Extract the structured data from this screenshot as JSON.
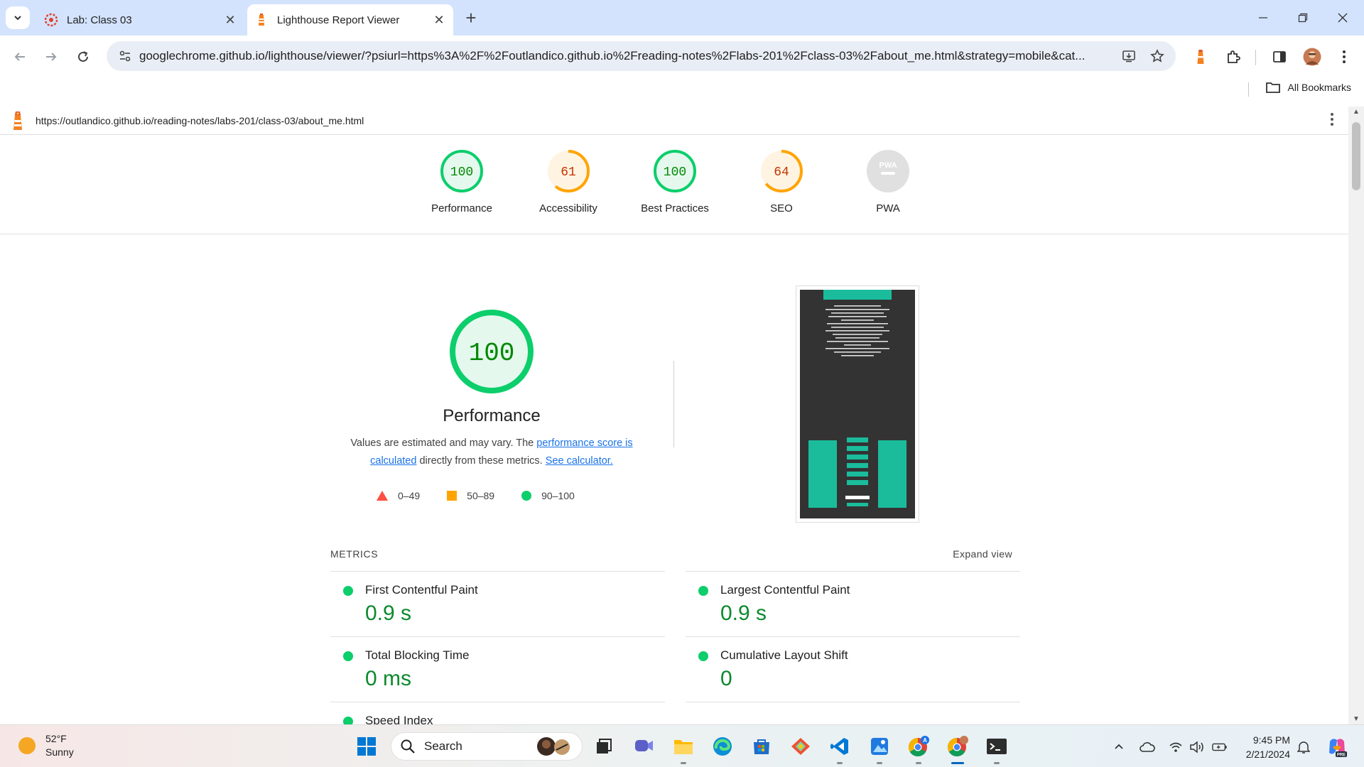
{
  "browser": {
    "tabs": [
      {
        "title": "Lab: Class 03",
        "active": false
      },
      {
        "title": "Lighthouse Report Viewer",
        "active": true
      }
    ],
    "omnibox_url": "googlechrome.github.io/lighthouse/viewer/?psiurl=https%3A%2F%2Foutlandico.github.io%2Freading-notes%2Flabs-201%2Fclass-03%2Fabout_me.html&strategy=mobile&cat...",
    "bookmarks_label": "All Bookmarks"
  },
  "report": {
    "page_url": "https://outlandico.github.io/reading-notes/labs-201/class-03/about_me.html",
    "categories": [
      {
        "label": "Performance",
        "score": "100",
        "value": 100,
        "rating": "pass"
      },
      {
        "label": "Accessibility",
        "score": "61",
        "value": 61,
        "rating": "average"
      },
      {
        "label": "Best Practices",
        "score": "100",
        "value": 100,
        "rating": "pass"
      },
      {
        "label": "SEO",
        "score": "64",
        "value": 64,
        "rating": "average"
      },
      {
        "label": "PWA",
        "score": "PWA",
        "value": null,
        "rating": "na"
      }
    ],
    "performance": {
      "score": "100",
      "title": "Performance",
      "desc_prefix": "Values are estimated and may vary. The ",
      "desc_link1": "performance score is calculated",
      "desc_middle": " directly from these metrics. ",
      "desc_link2": "See calculator.",
      "legend": [
        {
          "range": "0–49",
          "shape": "triangle",
          "color": "#ff4e42"
        },
        {
          "range": "50–89",
          "shape": "square",
          "color": "#ffa400"
        },
        {
          "range": "90–100",
          "shape": "circle",
          "color": "#0cce6b"
        }
      ]
    },
    "metrics_heading": "METRICS",
    "expand_label": "Expand view",
    "metrics": [
      {
        "name": "First Contentful Paint",
        "value": "0.9 s"
      },
      {
        "name": "Largest Contentful Paint",
        "value": "0.9 s"
      },
      {
        "name": "Total Blocking Time",
        "value": "0 ms"
      },
      {
        "name": "Cumulative Layout Shift",
        "value": "0"
      },
      {
        "name": "Speed Index",
        "value": ""
      }
    ]
  },
  "colors": {
    "pass": "#0cce6b",
    "pass_text": "#008800",
    "average": "#ffa400",
    "average_text": "#c33300",
    "link": "#1a73e8"
  },
  "taskbar": {
    "weather_temp": "52°F",
    "weather_desc": "Sunny",
    "search_label": "Search",
    "time": "9:45 PM",
    "date": "2/21/2024"
  }
}
